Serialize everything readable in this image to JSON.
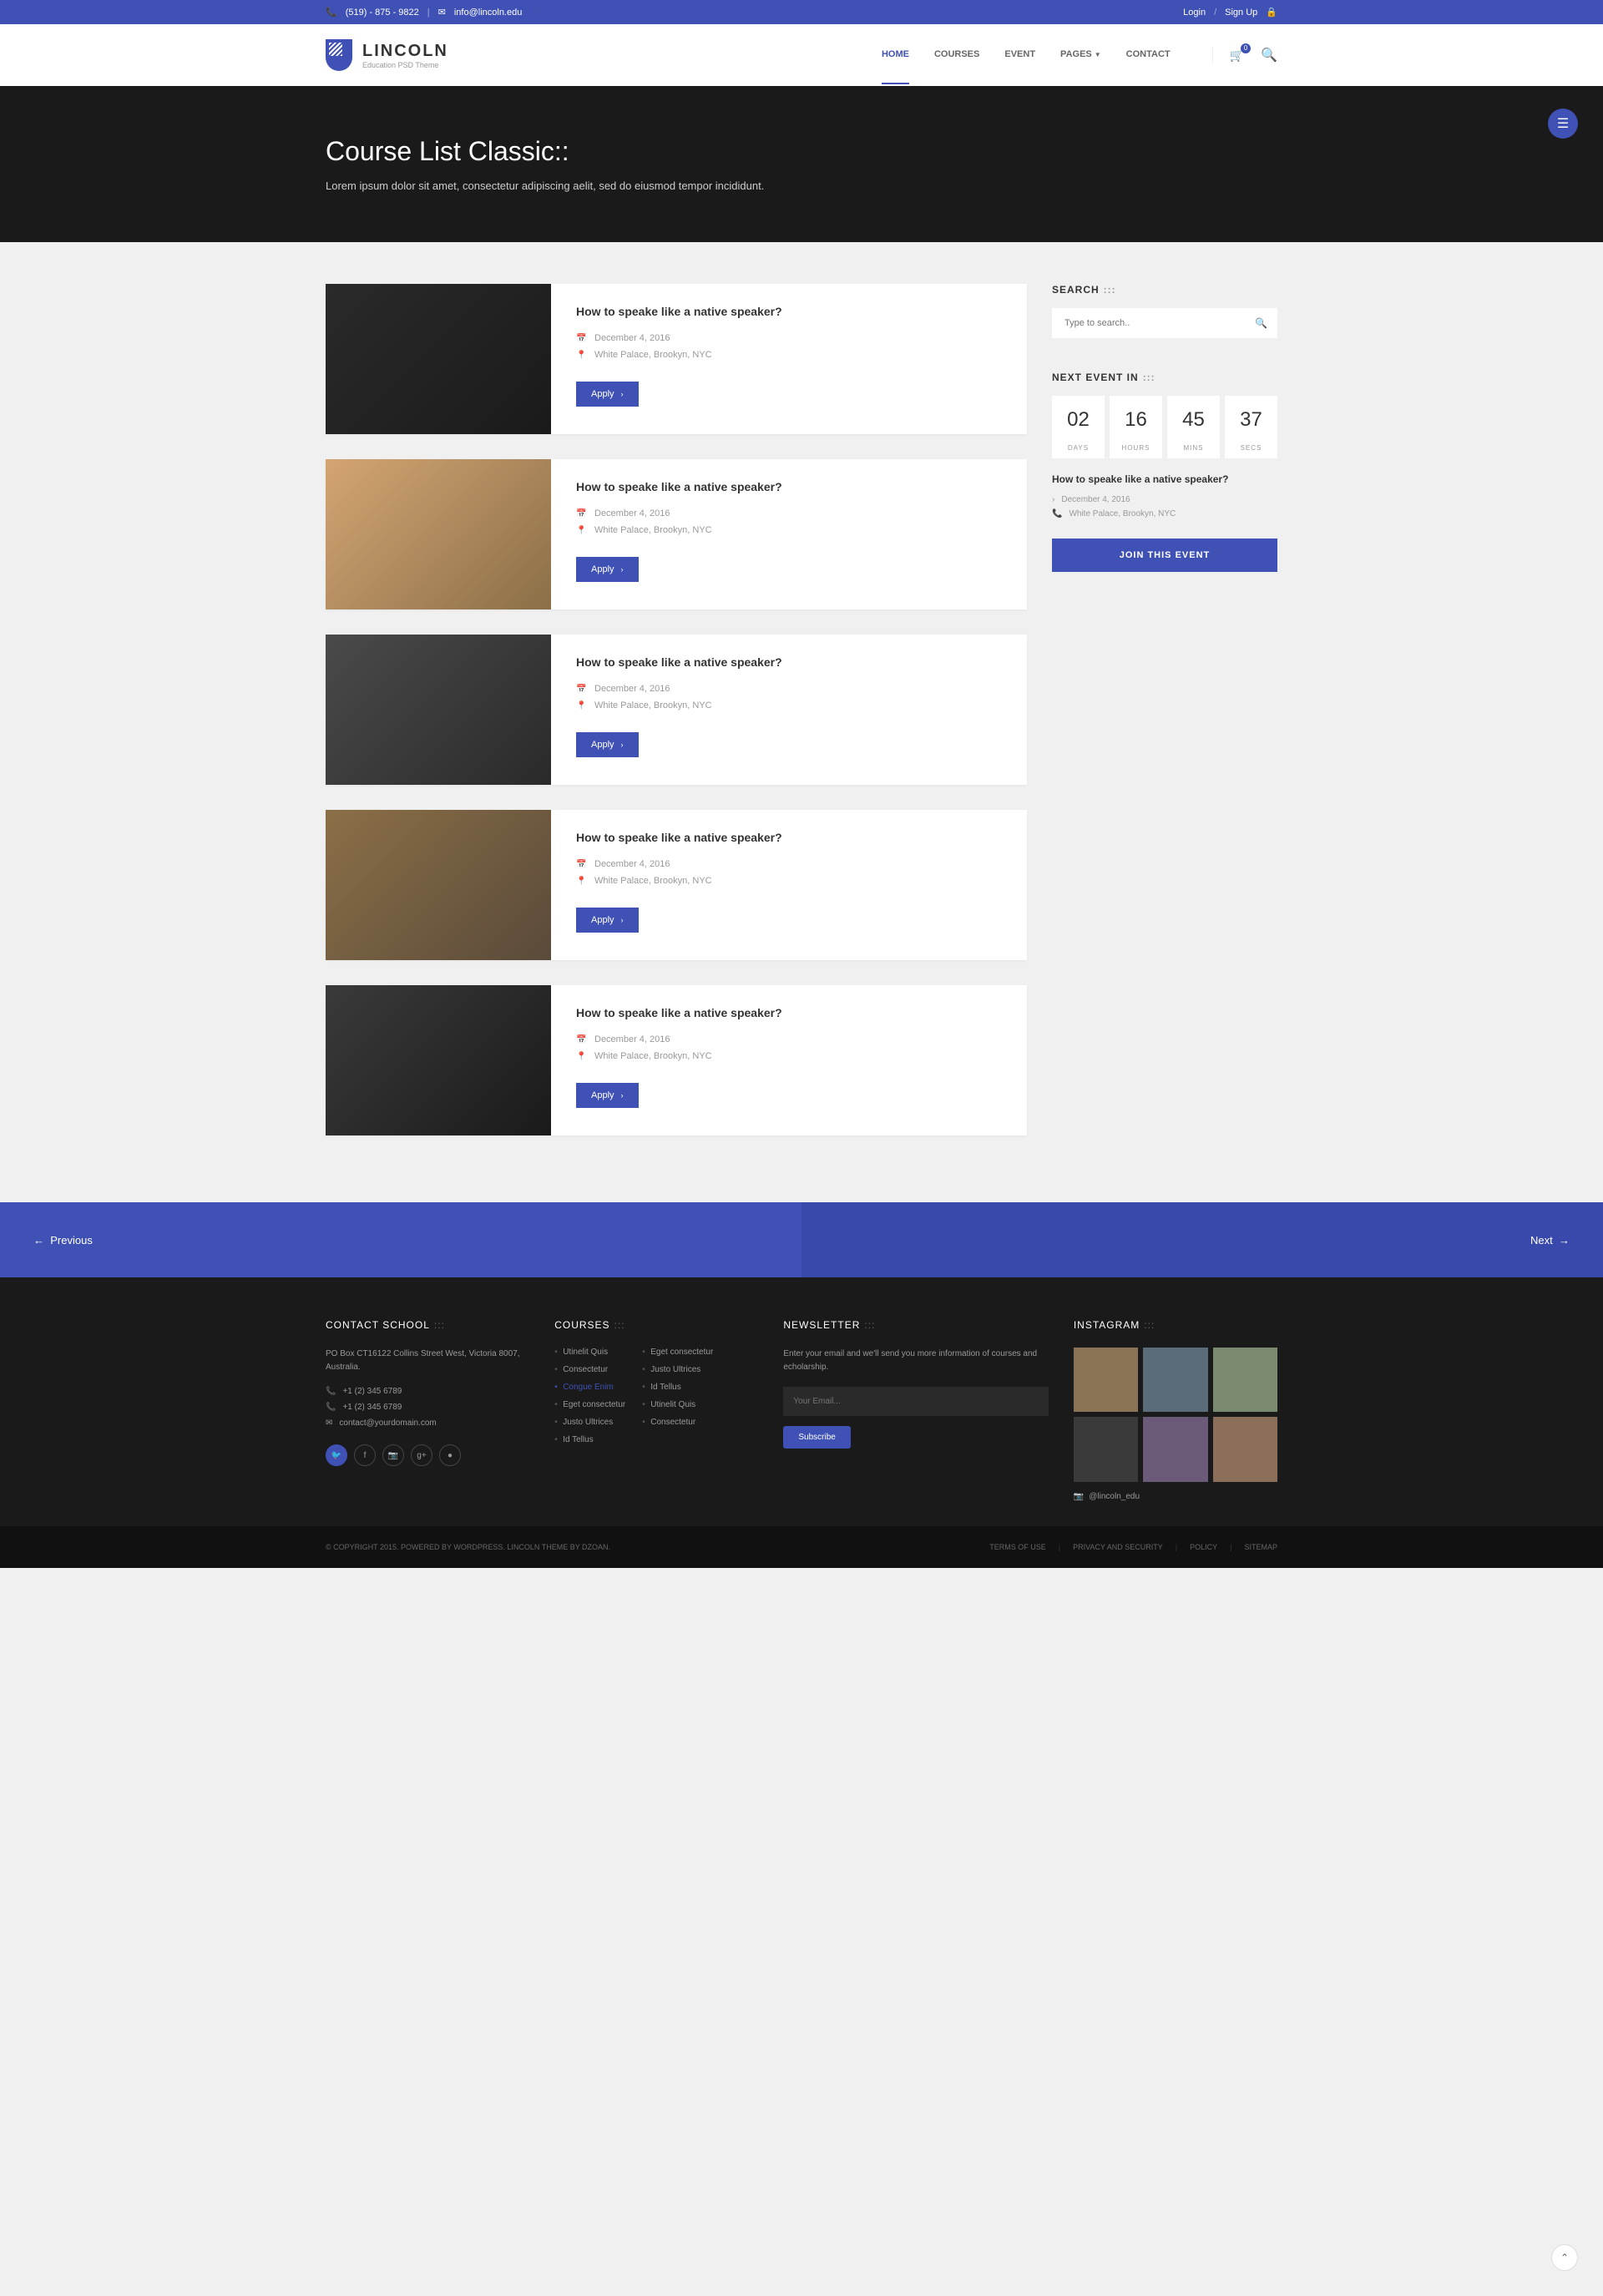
{
  "topbar": {
    "phone": "(519) - 875 - 9822",
    "email": "info@lincoln.edu",
    "login": "Login",
    "signup": "Sign Up"
  },
  "logo": {
    "title": "LINCOLN",
    "subtitle": "Education PSD Theme"
  },
  "nav": {
    "home": "HOME",
    "courses": "COURSES",
    "event": "EVENT",
    "pages": "PAGES",
    "contact": "CONTACT",
    "cart_count": "0"
  },
  "hero": {
    "title": "Course List Classic::",
    "subtitle": "Lorem ipsum dolor sit amet, consectetur adipiscing aelit, sed do eiusmod tempor incididunt."
  },
  "courses": [
    {
      "title": "How to speake like a native speaker?",
      "date": "December 4, 2016",
      "location": "White Palace, Brookyn, NYC",
      "apply": "Apply"
    },
    {
      "title": "How to speake like a native speaker?",
      "date": "December 4, 2016",
      "location": "White Palace, Brookyn, NYC",
      "apply": "Apply"
    },
    {
      "title": "How to speake like a native speaker?",
      "date": "December 4, 2016",
      "location": "White Palace, Brookyn, NYC",
      "apply": "Apply"
    },
    {
      "title": "How to speake like a native speaker?",
      "date": "December 4, 2016",
      "location": "White Palace, Brookyn, NYC",
      "apply": "Apply"
    },
    {
      "title": "How to speake like a native speaker?",
      "date": "December 4, 2016",
      "location": "White Palace, Brookyn, NYC",
      "apply": "Apply"
    }
  ],
  "sidebar": {
    "search_title": "SEARCH",
    "search_placeholder": "Type to search..",
    "event_title": "NEXT EVENT IN",
    "countdown": {
      "days": "02",
      "hours": "16",
      "mins": "45",
      "secs": "37",
      "days_label": "DAYS",
      "hours_label": "HOURS",
      "mins_label": "MINS",
      "secs_label": "SECS"
    },
    "event_name": "How to speake like a native speaker?",
    "event_date": "December 4, 2016",
    "event_location": "White Palace, Brookyn, NYC",
    "join_btn": "JOIN THIS EVENT"
  },
  "pagination": {
    "prev": "Previous",
    "next": "Next"
  },
  "footer": {
    "contact": {
      "title": "CONTACT SCHOOL",
      "address": "PO Box CT16122 Collins Street West, Victoria 8007, Australia.",
      "phone1": "+1 (2) 345 6789",
      "phone2": "+1 (2) 345 6789",
      "email": "contact@yourdomain.com"
    },
    "courses": {
      "title": "COURSES",
      "col1": [
        "Utinelit Quis",
        "Consectetur",
        "Congue Enim",
        "Eget consectetur",
        "Justo Ultrices",
        "Id Tellus"
      ],
      "col2": [
        "Eget consectetur",
        "Justo Ultrices",
        "Id Tellus",
        "Utinelit Quis",
        "Consectetur"
      ]
    },
    "newsletter": {
      "title": "NEWSLETTER",
      "text": "Enter your email and we'll send you more information of courses and echolarship.",
      "placeholder": "Your Email...",
      "button": "Subscribe"
    },
    "instagram": {
      "title": "INSTAGRAM",
      "handle": "@lincoln_edu"
    }
  },
  "footer_bottom": {
    "copyright": "© COPYRIGHT 2015. POWERED BY WORDPRESS. LINCOLN THEME BY DZOAN.",
    "links": [
      "TERMS OF USE",
      "PRIVACY AND SECURITY",
      "POLICY",
      "SITEMAP"
    ]
  }
}
